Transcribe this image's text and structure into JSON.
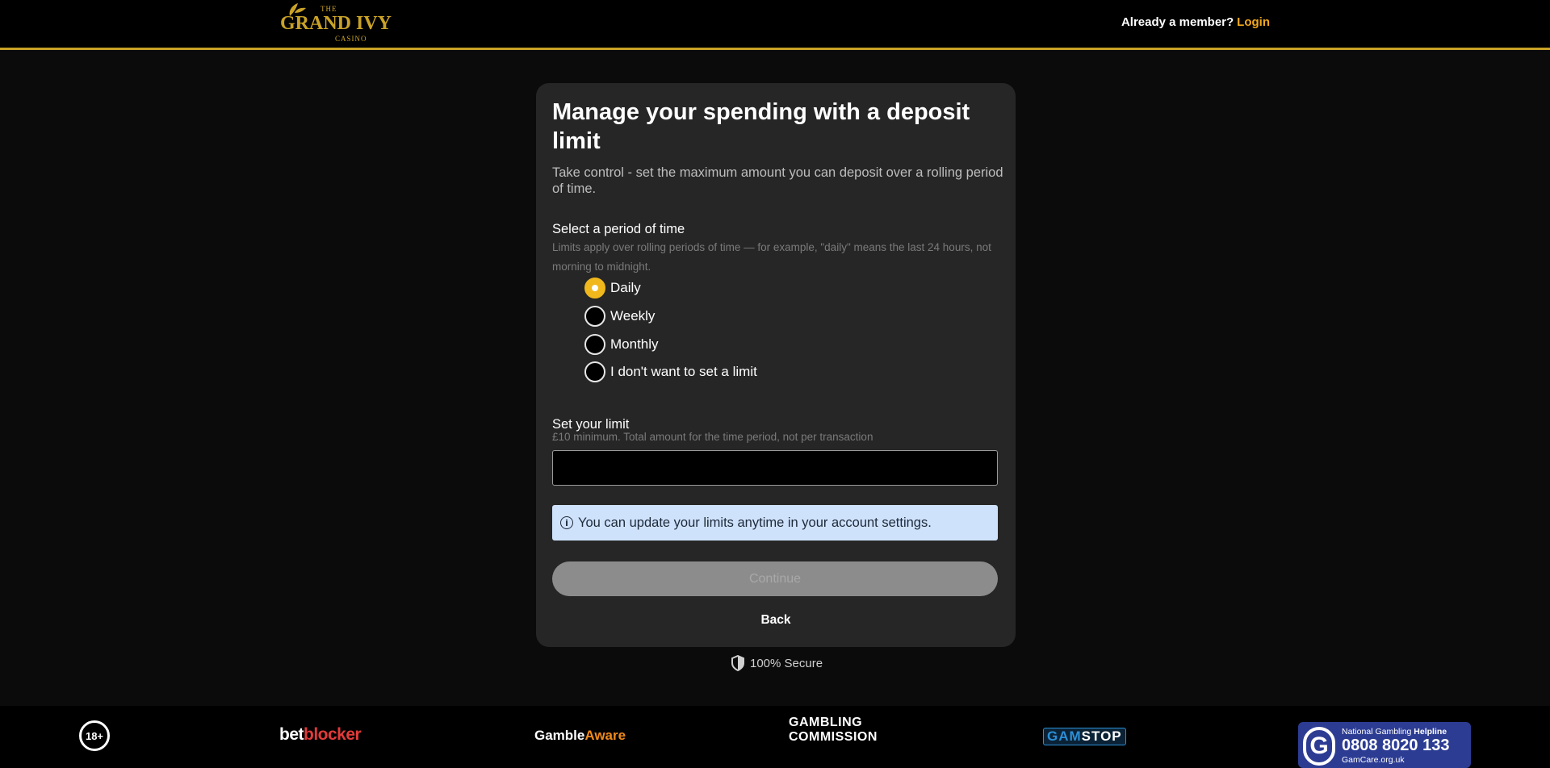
{
  "header": {
    "logo_the": "THE",
    "logo_name": "GRAND IVY",
    "logo_sub": "CASINO",
    "member_text": "Already a member?",
    "login_label": "Login"
  },
  "card": {
    "title": "Manage your spending with a deposit limit",
    "subtitle": "Take control - set the maximum amount you can deposit over a rolling period of time.",
    "period_label": "Select a period of time",
    "period_hint": "Limits apply over rolling periods of time — for example, \"daily\" means the last 24 hours, not morning to midnight.",
    "options": [
      {
        "label": "Daily",
        "checked": true
      },
      {
        "label": "Weekly",
        "checked": false
      },
      {
        "label": "Monthly",
        "checked": false
      },
      {
        "label": "I don't want to set a limit",
        "checked": false
      }
    ],
    "limit_label": "Set your limit",
    "limit_hint": "£10 minimum. Total amount for the time period, not per transaction",
    "limit_value": "",
    "info_text": "You can update your limits anytime in your account settings.",
    "continue_label": "Continue",
    "back_label": "Back"
  },
  "secure_text": "100% Secure",
  "footer": {
    "age": "18+",
    "betblocker_a": "bet",
    "betblocker_b": "blocker",
    "gambleaware_a": "Gamble",
    "gambleaware_b": "Aware",
    "commission_1": "GAMBLING",
    "commission_2": "COMMISSION",
    "gamstop_a": "GAM",
    "gamstop_b": "STOP",
    "helpline_g": "G",
    "helpline_line1a": "National Gambling ",
    "helpline_line1b": "Helpline",
    "helpline_number": "0808 8020 133",
    "helpline_site": "GamCare.org.uk"
  },
  "colors": {
    "accent": "#f0b81c",
    "login": "#f0a81e",
    "card_bg": "#262626",
    "info_bg": "#cfe2fb"
  }
}
